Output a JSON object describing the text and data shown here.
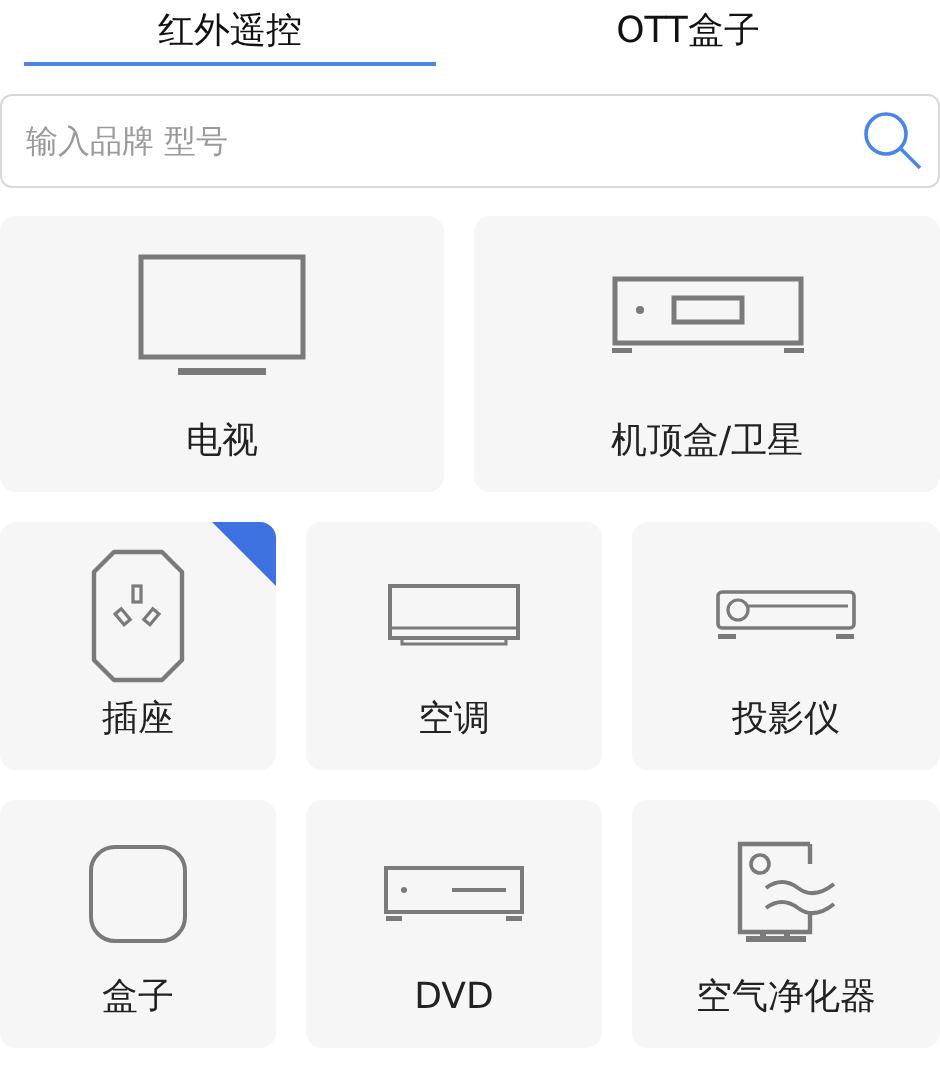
{
  "tabs": [
    {
      "label": "红外遥控",
      "selected": true
    },
    {
      "label": "OTT盒子",
      "selected": false
    }
  ],
  "search": {
    "placeholder": "输入品牌 型号"
  },
  "large_devices": [
    {
      "label": "电视"
    },
    {
      "label": "机顶盒/卫星"
    }
  ],
  "devices": [
    {
      "label": "插座",
      "flagged": true
    },
    {
      "label": "空调",
      "flagged": false
    },
    {
      "label": "投影仪",
      "flagged": false
    },
    {
      "label": "盒子",
      "flagged": false
    },
    {
      "label": "DVD",
      "flagged": false
    },
    {
      "label": "空气净化器",
      "flagged": false
    }
  ]
}
